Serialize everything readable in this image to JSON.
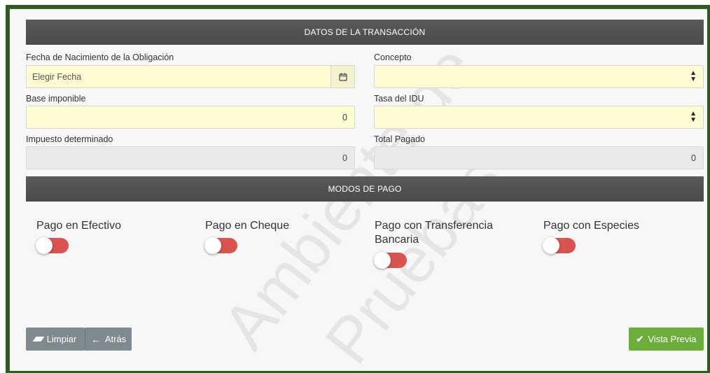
{
  "sections": {
    "transaction_title": "DATOS DE LA TRANSACCIÓN",
    "payment_title": "MODOS DE PAGO"
  },
  "form": {
    "fecha_label": "Fecha de Nacimiento de la Obligación",
    "fecha_placeholder": "Elegir Fecha",
    "concepto_label": "Concepto",
    "concepto_value": "",
    "base_label": "Base imponible",
    "base_value": "0",
    "tasa_label": "Tasa del IDU",
    "tasa_value": "",
    "impuesto_label": "Impuesto determinado",
    "impuesto_value": "0",
    "total_label": "Total Pagado",
    "total_value": "0"
  },
  "payment_modes": [
    {
      "label": "Pago en Efectivo",
      "enabled": false
    },
    {
      "label": "Pago en Cheque",
      "enabled": false
    },
    {
      "label": "Pago con Transferencia Bancaria",
      "enabled": false
    },
    {
      "label": "Pago con Especies",
      "enabled": false
    }
  ],
  "buttons": {
    "limpiar": "Limpiar",
    "atras": "Atrás",
    "vista_previa": "Vista Previa"
  },
  "watermark": {
    "line1": "Ambiente de",
    "line2": "Pruebas"
  },
  "colors": {
    "field_bg": "#fdfcd2",
    "disabled_bg": "#e8eaeb",
    "section_bar": "#4f4f4f",
    "toggle_off": "#d9534f",
    "primary_green": "#6cae3c",
    "button_gray": "#7e8a8f",
    "frame_green": "#2f5b1f"
  },
  "icons": {
    "calendar": "calendar-icon",
    "select": "sort-icon",
    "eraser": "eraser-icon",
    "back": "arrow-left-icon",
    "check": "check-icon"
  }
}
